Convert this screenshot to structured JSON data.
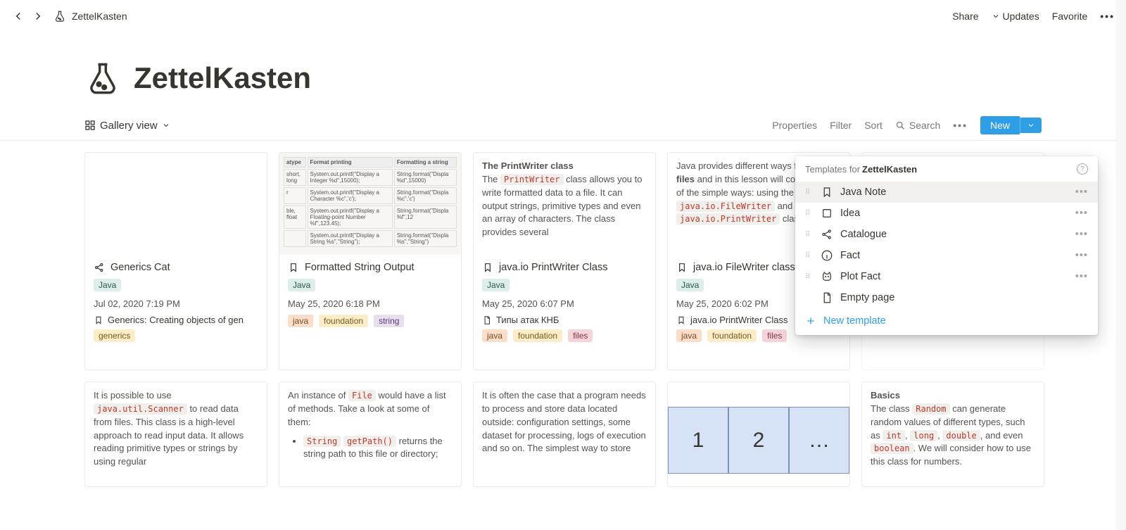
{
  "breadcrumb": "ZettelKasten",
  "top_actions": {
    "share": "Share",
    "updates": "Updates",
    "favorite": "Favorite"
  },
  "page_title": "ZettelKasten",
  "view_label": "Gallery view",
  "view_actions": {
    "properties": "Properties",
    "filter": "Filter",
    "sort": "Sort",
    "search": "Search",
    "new": "New"
  },
  "templates_popup": {
    "header_prefix": "Templates for ",
    "header_name": "ZettelKasten",
    "items": [
      {
        "icon": "bookmark",
        "label": "Java Note",
        "active": true
      },
      {
        "icon": "note",
        "label": "Idea"
      },
      {
        "icon": "share-nodes",
        "label": "Catalogue"
      },
      {
        "icon": "info",
        "label": "Fact"
      },
      {
        "icon": "cat",
        "label": "Plot Fact"
      }
    ],
    "empty": "Empty page",
    "new_template": "New template"
  },
  "cards_row1": [
    {
      "icon": "share-nodes",
      "title": "Generics Cat",
      "lang_tag": "Java",
      "date": "Jul 02, 2020 7:19 PM",
      "link_icon": "bookmark",
      "link": "Generics: Creating objects of gen",
      "tags": [
        {
          "text": "generics",
          "cls": "yellow"
        }
      ],
      "preview": {
        "type": "blank"
      }
    },
    {
      "icon": "bookmark",
      "title": "Formatted String Output",
      "lang_tag": "Java",
      "date": "May 25, 2020 6:18 PM",
      "tags": [
        {
          "text": "java",
          "cls": "orange"
        },
        {
          "text": "foundation",
          "cls": "yellow"
        },
        {
          "text": "string",
          "cls": "purple"
        }
      ],
      "preview": {
        "type": "table"
      }
    },
    {
      "icon": "bookmark",
      "title": "java.io PrintWriter Class",
      "lang_tag": "Java",
      "date": "May 25, 2020 6:07 PM",
      "link_icon": "page",
      "link": "Типы атак КНБ",
      "tags": [
        {
          "text": "java",
          "cls": "orange"
        },
        {
          "text": "foundation",
          "cls": "yellow"
        },
        {
          "text": "files",
          "cls": "pink"
        }
      ],
      "preview": {
        "type": "text",
        "heading": "The PrintWriter class",
        "body_parts": [
          "The ",
          " class allows you to write formatted data to a file. It can output strings, primitive types and even an array of characters. The class provides several"
        ],
        "code": "PrintWriter"
      }
    },
    {
      "icon": "bookmark",
      "title": "java.io FileWriter class",
      "lang_tag": "Java",
      "date": "May 25, 2020 6:02 PM",
      "link_icon": "bookmark",
      "link": "java.io PrintWriter Class",
      "tags": [
        {
          "text": "java",
          "cls": "orange"
        },
        {
          "text": "foundation",
          "cls": "yellow"
        },
        {
          "text": "files",
          "cls": "pink"
        }
      ],
      "preview": {
        "type": "text2",
        "pre": "Java provides different ways fo",
        "bold": "writing files",
        "post": " and in this lesson will consider two of the simple ways: using the ",
        "code1": "java.io.FileWriter",
        "mid": " and the ",
        "code2": "java.io.PrintWriter",
        "tail": " classes."
      }
    },
    {
      "faded": true
    }
  ],
  "cards_row2": [
    {
      "preview_text": "It is possible to use ",
      "code": "java.util.Scanner",
      "rest": " to read data from files. This class is a high-level approach to read input data. It allows reading primitive types or strings by using regular"
    },
    {
      "preview_text": "An instance of ",
      "code": "File",
      "rest": " would have a list of methods. Take a look at some of them:",
      "bullet_code1": "String",
      "bullet_code2": "getPath()",
      "bullet_rest": " returns the string path to this file or directory;"
    },
    {
      "preview_text": "It is often the case that a program needs to process and store data located outside: configuration settings, some dataset for processing, logs of execution and so on. The simplest way to store"
    },
    {
      "array": [
        "1",
        "2",
        "…"
      ]
    },
    {
      "heading": "Basics",
      "preview_text": "The class ",
      "code": "Random",
      "rest": " can generate random values of different types, such as ",
      "code2": "int",
      "sep1": ", ",
      "code3": "long",
      "sep2": ", ",
      "code4": "double",
      "sep3": ", and even ",
      "code5": "boolean",
      "tail": ". We will consider how to use this class for numbers."
    }
  ],
  "fake_table": {
    "h1": "atype",
    "h2": "Format printing",
    "h3": "Formatting a string",
    "rows": [
      [
        "short, long",
        "System.out.printf(\"Display a Integer %d\",15000);",
        "String.format(\"Displa %d\",15000)"
      ],
      [
        "r",
        "System.out.printf(\"Display a Character %c\",'c');",
        "String.format(\"Displa %c\",'c')"
      ],
      [
        "ble, float",
        "System.out.printf(\"Display a Floating-point Number %f\",123.45);",
        "String.format(\"Displa %f\",12"
      ],
      [
        "",
        "System.out.printf(\"Display a String %s\",\"String\");",
        "String.format(\"Displa %s\",\"String\")"
      ]
    ]
  }
}
